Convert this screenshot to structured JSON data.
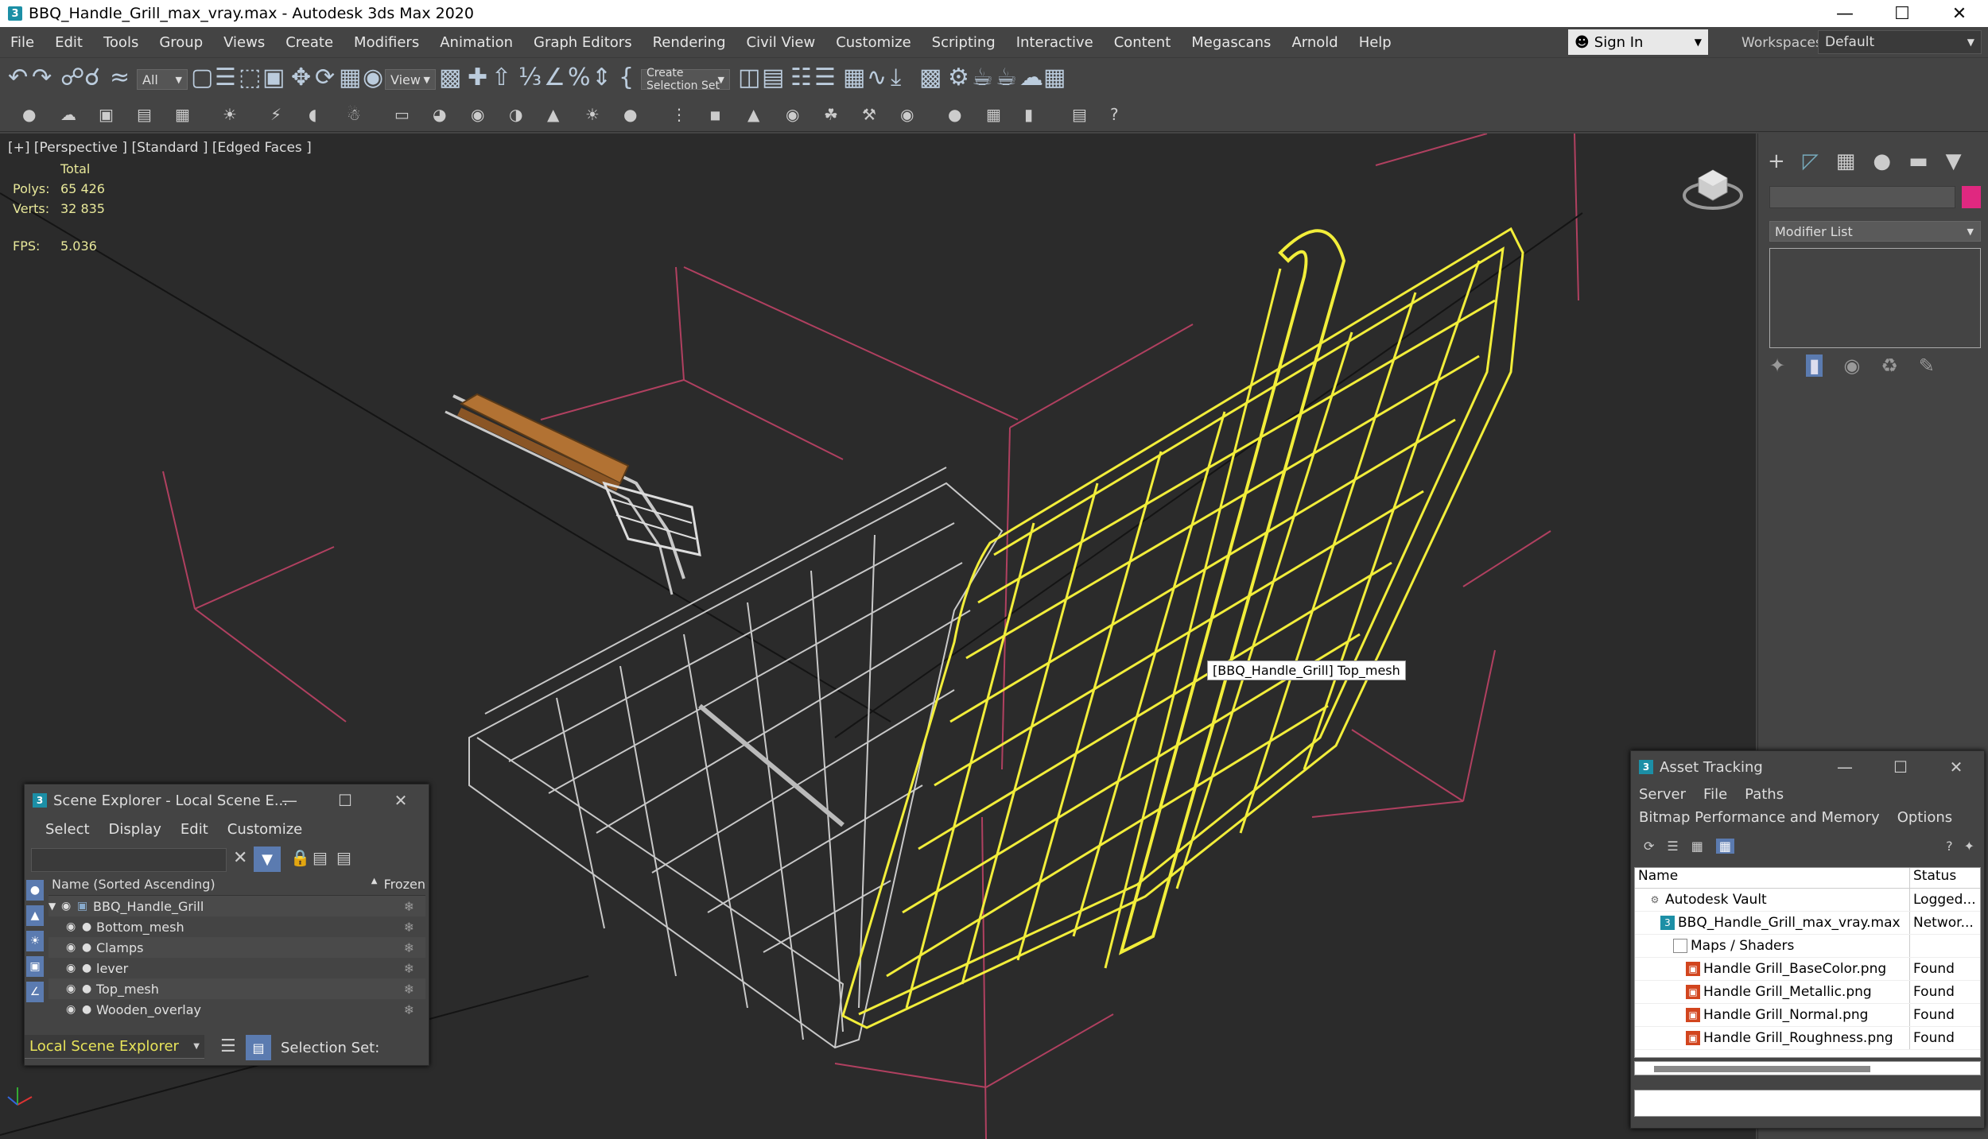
{
  "window": {
    "title": "BBQ_Handle_Grill_max_vray.max - Autodesk 3ds Max 2020",
    "app_icon": "3"
  },
  "menu": [
    "File",
    "Edit",
    "Tools",
    "Group",
    "Views",
    "Create",
    "Modifiers",
    "Animation",
    "Graph Editors",
    "Rendering",
    "Civil View",
    "Customize",
    "Scripting",
    "Interactive",
    "Content",
    "Megascans",
    "Arnold",
    "Help"
  ],
  "signin": {
    "label": "Sign In"
  },
  "workspaces": {
    "label": "Workspaces:",
    "value": "Default"
  },
  "toolbar": {
    "filter_value": "All",
    "refcoord_value": "View",
    "selection_set_placeholder": "Create Selection Set"
  },
  "viewport": {
    "label": "[+] [Perspective ] [Standard ] [Edged Faces ]",
    "stats": {
      "total_label": "Total",
      "polys_label": "Polys:",
      "polys_value": "65 426",
      "verts_label": "Verts:",
      "verts_value": "32 835",
      "fps_label": "FPS:",
      "fps_value": "5.036"
    },
    "tooltip": "[BBQ_Handle_Grill] Top_mesh",
    "colors": {
      "background": "#2b2b2b",
      "selected_wire": "#f2ee3a",
      "wire": "#c8c8c8",
      "wood": "#b27233",
      "grid_lines": "#b04060"
    }
  },
  "command_panel": {
    "modifier_list_label": "Modifier List",
    "object_color": "#e02880"
  },
  "scene_explorer": {
    "title": "Scene Explorer - Local Scene E...",
    "menu": [
      "Select",
      "Display",
      "Edit",
      "Customize"
    ],
    "columns": {
      "name": "Name (Sorted Ascending)",
      "frozen": "Frozen"
    },
    "rows": [
      {
        "name": "BBQ_Handle_Grill"
      },
      {
        "name": "Bottom_mesh"
      },
      {
        "name": "Clamps"
      },
      {
        "name": "lever"
      },
      {
        "name": "Top_mesh"
      },
      {
        "name": "Wooden_overlay"
      }
    ],
    "bottom_dropdown": "Local Scene Explorer",
    "selection_set_label": "Selection Set:"
  },
  "asset_tracking": {
    "title": "Asset Tracking",
    "menu": [
      "Server",
      "File",
      "Paths",
      "Bitmap Performance and Memory",
      "Options"
    ],
    "columns": {
      "name": "Name",
      "status": "Status"
    },
    "rows": [
      {
        "name": "Autodesk Vault",
        "status": "Logged...",
        "icon": "vault-icon"
      },
      {
        "name": "BBQ_Handle_Grill_max_vray.max",
        "status": "Networ...",
        "icon": "max-file-icon"
      },
      {
        "name": "Maps / Shaders",
        "status": "",
        "icon": "folder-icon"
      },
      {
        "name": "Handle Grill_BaseColor.png",
        "status": "Found",
        "icon": "png-icon"
      },
      {
        "name": "Handle Grill_Metallic.png",
        "status": "Found",
        "icon": "png-icon"
      },
      {
        "name": "Handle Grill_Normal.png",
        "status": "Found",
        "icon": "png-icon"
      },
      {
        "name": "Handle Grill_Roughness.png",
        "status": "Found",
        "icon": "png-icon"
      }
    ]
  }
}
